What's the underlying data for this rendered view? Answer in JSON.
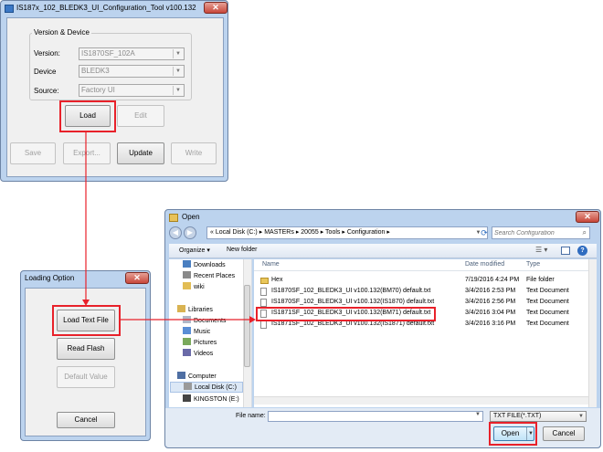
{
  "config_tool": {
    "title": "IS187x_102_BLEDK3_UI_Configuration_Tool v100.132",
    "close": "✕",
    "group_title": "Version & Device",
    "version_label": "Version:",
    "version_value": "IS1870SF_102A",
    "device_label": "Device",
    "device_value": "BLEDK3",
    "source_label": "Source:",
    "source_value": "Factory UI",
    "load": "Load",
    "edit": "Edit",
    "save": "Save",
    "export": "Export...",
    "update": "Update",
    "write": "Write"
  },
  "loading_option": {
    "title": "Loading Option",
    "close": "✕",
    "load_text_file": "Load Text File",
    "read_flash": "Read Flash",
    "default_value": "Default Value",
    "cancel": "Cancel"
  },
  "open_dialog": {
    "title": "Open",
    "close": "✕",
    "path": {
      "prefix": "«",
      "segments": [
        "Local Disk (C:)",
        "MASTERs",
        "20055",
        "Tools",
        "Configuration"
      ],
      "separator": "▸"
    },
    "search_placeholder": "Search Configuration",
    "organize": "Organize ▾",
    "new_folder": "New folder",
    "nav": [
      {
        "label": "Downloads",
        "color": "#4a7fc1"
      },
      {
        "label": "Recent Places",
        "color": "#8a8a8a"
      },
      {
        "label": "wiki",
        "color": "#e2bd55"
      },
      {
        "label": "Libraries",
        "color": "#d9b352"
      },
      {
        "label": "Documents",
        "color": "#b0b8c8"
      },
      {
        "label": "Music",
        "color": "#5a8ed6"
      },
      {
        "label": "Pictures",
        "color": "#7aa95c"
      },
      {
        "label": "Videos",
        "color": "#6a6aa8"
      },
      {
        "label": "Computer",
        "color": "#4f6fa3"
      },
      {
        "label": "Local Disk (C:)",
        "color": "#9a9a9a"
      },
      {
        "label": "KINGSTON (E:)",
        "color": "#444444"
      }
    ],
    "columns": {
      "name": "Name",
      "date": "Date modified",
      "type": "Type"
    },
    "files": [
      {
        "name": "Hex",
        "date": "7/19/2016 4:24 PM",
        "type": "File folder",
        "folder": true
      },
      {
        "name": "IS1870SF_102_BLEDK3_UI v100.132(BM70) default.txt",
        "date": "3/4/2016 2:53 PM",
        "type": "Text Document"
      },
      {
        "name": "IS1870SF_102_BLEDK3_UI v100.132(IS1870) default.txt",
        "date": "3/4/2016 2:56 PM",
        "type": "Text Document"
      },
      {
        "name": "IS1871SF_102_BLEDK3_UI v100.132(BM71) default.txt",
        "date": "3/4/2016 3:04 PM",
        "type": "Text Document"
      },
      {
        "name": "IS1871SF_102_BLEDK3_UI v100.132(IS1871) default.txt",
        "date": "3/4/2016 3:16 PM",
        "type": "Text Document"
      }
    ],
    "file_name_label": "File name:",
    "file_name_value": "",
    "filter": "TXT FILE(*.TXT)",
    "open": "Open",
    "cancel": "Cancel"
  },
  "colors": {
    "highlight": "#e8212a",
    "connector": "#e8212a"
  }
}
